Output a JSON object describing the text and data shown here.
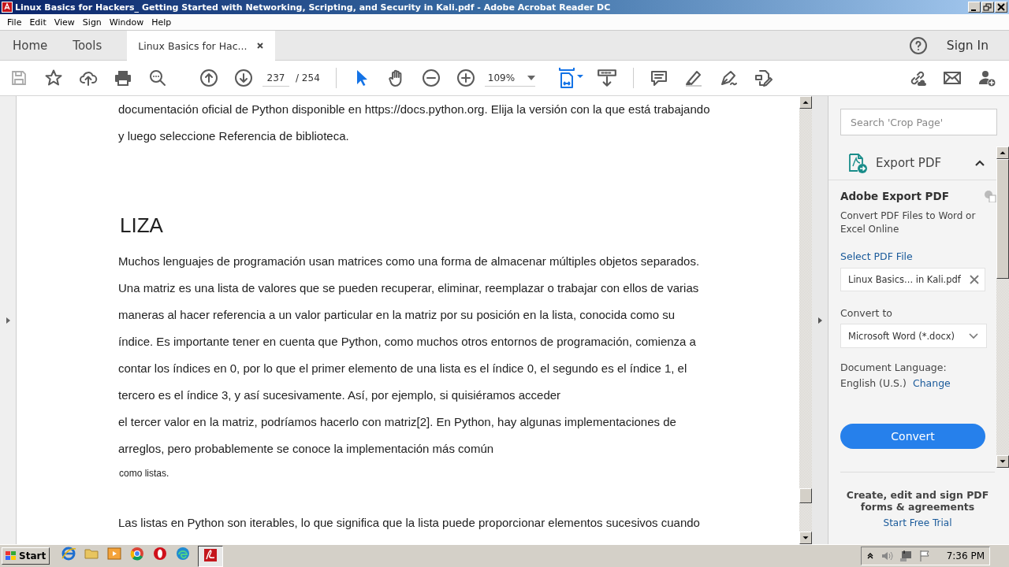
{
  "window": {
    "title": "Linux Basics for Hackers_ Getting Started with Networking, Scripting, and Security in Kali.pdf - Adobe Acrobat Reader DC"
  },
  "menu": [
    "File",
    "Edit",
    "View",
    "Sign",
    "Window",
    "Help"
  ],
  "tabs": [
    {
      "label": "Home",
      "kind": "nav",
      "selected": false
    },
    {
      "label": "Tools",
      "kind": "nav",
      "selected": false
    },
    {
      "label": "Linux Basics for Hac...",
      "kind": "document",
      "selected": true
    }
  ],
  "sign_in": "Sign In",
  "toolbar": {
    "page_current": "237",
    "page_total": "/ 254",
    "zoom": "109%"
  },
  "document": {
    "paragraphs": [
      {
        "kind": "body",
        "lines": [
          "documentación oficial de Python disponible en https://docs.python.org. Elija la versión con la que está trabajando",
          "y luego seleccione Referencia de biblioteca."
        ]
      },
      {
        "kind": "heading",
        "lines": [
          "LIZA"
        ]
      },
      {
        "kind": "body",
        "lines": [
          "Muchos lenguajes de programación usan matrices como una forma de almacenar múltiples objetos separados.",
          "Una matriz es una lista de valores que se pueden recuperar, eliminar, reemplazar o trabajar con ellos de varias",
          "maneras al hacer referencia a un valor particular en la matriz por su posición en la lista, conocida como su",
          "índice. Es importante tener en cuenta que Python, como muchos otros entornos de programación, comienza a",
          "contar los índices en 0, por lo que el primer elemento de una lista es el índice 0, el segundo es el índice 1, el",
          "tercero es el índice 3, y así sucesivamente. Así, por ejemplo, si quisiéramos acceder",
          "el tercer valor en la matriz, podríamos hacerlo con matriz[2]. En Python, hay algunas implementaciones de",
          "arreglos, pero probablemente se conoce la implementación más común"
        ]
      },
      {
        "kind": "note",
        "lines": [
          "como listas."
        ]
      },
      {
        "kind": "body",
        "lines": [
          "Las listas en Python son iterables, lo que significa que la lista puede proporcionar elementos sucesivos cuando"
        ]
      }
    ]
  },
  "panel": {
    "search_placeholder": "Search 'Crop Page'",
    "section_title": "Export PDF",
    "expanded": true,
    "heading": "Adobe Export PDF",
    "description": "Convert PDF Files to Word or Excel Online",
    "select_label": "Select PDF File",
    "file_name": "Linux Basics... in Kali.pdf",
    "convert_to_label": "Convert to",
    "format": "Microsoft Word (*.docx)",
    "language_label": "Document Language:",
    "language": "English (U.S.)",
    "change_link": "Change",
    "convert_button": "Convert",
    "promo": "Create, edit and sign PDF forms & agreements",
    "trial_link": "Start Free Trial"
  },
  "taskbar": {
    "start": "Start",
    "clock": "7:36 PM"
  }
}
